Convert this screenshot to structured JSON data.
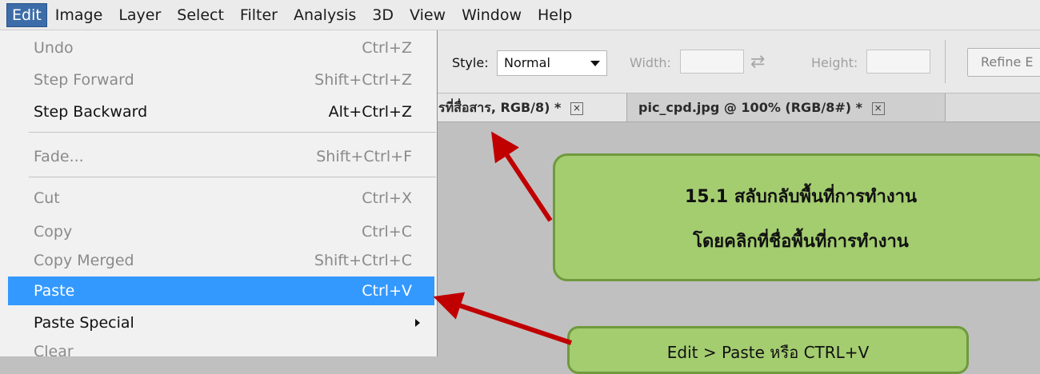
{
  "menubar": {
    "items": [
      "Edit",
      "Image",
      "Layer",
      "Select",
      "Filter",
      "Analysis",
      "3D",
      "View",
      "Window",
      "Help"
    ]
  },
  "options_bar": {
    "style_label": "Style:",
    "style_value": "Normal",
    "width_label": "Width:",
    "height_label": "Height:",
    "refine_label": "Refine E"
  },
  "tabs": [
    {
      "label": "รที่สื่อสาร, RGB/8) *",
      "close": "×"
    },
    {
      "label": "pic_cpd.jpg @ 100% (RGB/8#) *",
      "close": "×"
    }
  ],
  "edit_menu": {
    "items": [
      {
        "label": "Undo",
        "shortcut": "Ctrl+Z",
        "state": "disabled"
      },
      {
        "label": "Step Forward",
        "shortcut": "Shift+Ctrl+Z",
        "state": "disabled"
      },
      {
        "label": "Step Backward",
        "shortcut": "Alt+Ctrl+Z",
        "state": "enabled"
      },
      {
        "label": "Fade...",
        "shortcut": "Shift+Ctrl+F",
        "state": "disabled"
      },
      {
        "label": "Cut",
        "shortcut": "Ctrl+X",
        "state": "disabled"
      },
      {
        "label": "Copy",
        "shortcut": "Ctrl+C",
        "state": "disabled"
      },
      {
        "label": "Copy Merged",
        "shortcut": "Shift+Ctrl+C",
        "state": "disabled"
      },
      {
        "label": "Paste",
        "shortcut": "Ctrl+V",
        "state": "highlighted"
      },
      {
        "label": "Paste Special",
        "shortcut": "",
        "state": "enabled"
      },
      {
        "label": "Clear",
        "shortcut": "",
        "state": "disabled"
      }
    ]
  },
  "callouts": {
    "workspace_switch": {
      "line1": "15.1 สลับกลับพื้นที่การทำงาน",
      "line2": "โดยคลิกที่ชื่อพื้นที่การทำงาน"
    },
    "paste": {
      "line1": "Edit > Paste หรือ CTRL+V"
    }
  },
  "colors": {
    "menu_highlight": "#3399ff",
    "callout_fill": "#a4cd70",
    "callout_border": "#6f9a3d",
    "arrow": "#c00000"
  }
}
